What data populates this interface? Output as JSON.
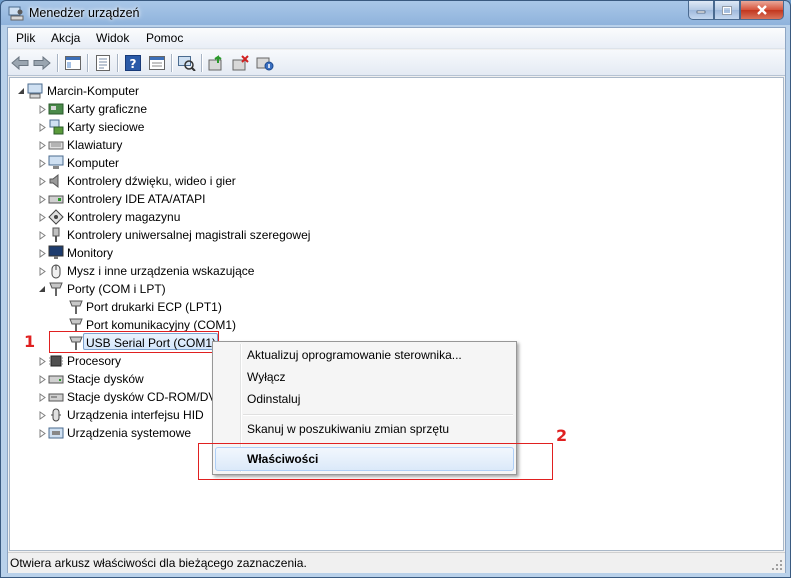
{
  "window": {
    "title": "Menedżer urządzeń"
  },
  "menu": [
    "Plik",
    "Akcja",
    "Widok",
    "Pomoc"
  ],
  "toolbar": {
    "buttons": [
      "back-icon",
      "forward-icon",
      "show-hide-tree-icon",
      "properties-icon",
      "help-icon",
      "view-icon",
      "scan-hardware-icon",
      "update-driver-icon",
      "uninstall-icon",
      "disable-icon"
    ]
  },
  "tree": {
    "root": "Marcin-Komputer",
    "categories": [
      "Karty graficzne",
      "Karty sieciowe",
      "Klawiatury",
      "Komputer",
      "Kontrolery dźwięku, wideo i gier",
      "Kontrolery IDE ATA/ATAPI",
      "Kontrolery magazynu",
      "Kontrolery uniwersalnej magistrali szeregowej",
      "Monitory",
      "Mysz i inne urządzenia wskazujące",
      "Porty (COM i LPT)",
      "Procesory",
      "Stacje dysków",
      "Stacje dysków CD-ROM/DV",
      "Urządzenia interfejsu HID",
      "Urządzenia systemowe"
    ],
    "ports": [
      "Port drukarki ECP (LPT1)",
      "Port komunikacyjny (COM1)",
      "USB Serial Port (COM1)"
    ]
  },
  "context_menu": {
    "update": "Aktualizuj oprogramowanie sterownika...",
    "disable": "Wyłącz",
    "uninstall": "Odinstaluj",
    "scan": "Skanuj w poszukiwaniu zmian sprzętu",
    "properties": "Właściwości"
  },
  "annotations": {
    "one": "1",
    "two": "2"
  },
  "status": "Otwiera arkusz właściwości dla bieżącego zaznaczenia.",
  "colors": {
    "annotation": "#e02020",
    "selection": "#d4e6fb"
  }
}
